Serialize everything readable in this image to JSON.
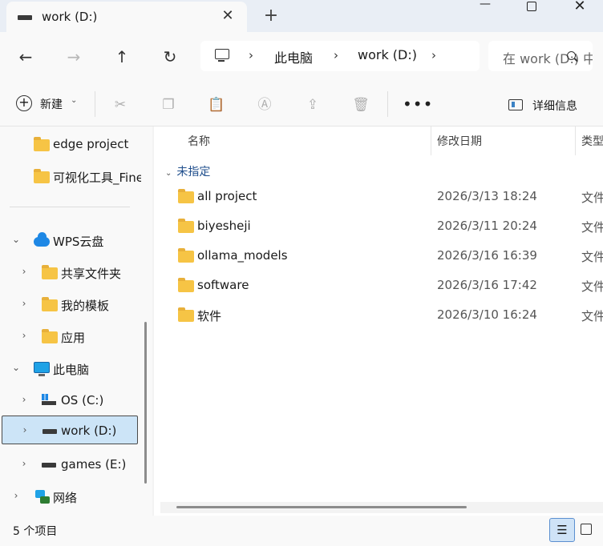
{
  "window": {
    "tab_title": "work (D:)"
  },
  "address": {
    "segments": [
      "此电脑",
      "work (D:)"
    ],
    "search_placeholder": "在 work (D:) 中搜索"
  },
  "toolbar": {
    "new_label": "新建",
    "details_label": "详细信息"
  },
  "sidebar": {
    "items": [
      {
        "label": "edge project"
      },
      {
        "label": "可视化工具_FineBI"
      },
      {
        "label": "WPS云盘"
      },
      {
        "label": "共享文件夹"
      },
      {
        "label": "我的模板"
      },
      {
        "label": "应用"
      },
      {
        "label": "此电脑"
      },
      {
        "label": "OS (C:)"
      },
      {
        "label": "work (D:)"
      },
      {
        "label": "games (E:)"
      },
      {
        "label": "网络"
      }
    ]
  },
  "main": {
    "columns": {
      "name": "名称",
      "modified": "修改日期",
      "type": "类型"
    },
    "group": "未指定",
    "rows": [
      {
        "name": "all project",
        "date": "2026/3/13 18:24",
        "type": "文件夹"
      },
      {
        "name": "biyesheji",
        "date": "2026/3/11 20:24",
        "type": "文件夹"
      },
      {
        "name": "ollama_models",
        "date": "2026/3/16 16:39",
        "type": "文件夹"
      },
      {
        "name": "software",
        "date": "2026/3/16 17:42",
        "type": "文件夹"
      },
      {
        "name": "软件",
        "date": "2026/3/10 16:24",
        "type": "文件夹"
      }
    ]
  },
  "status": {
    "count": "5 个项目"
  }
}
